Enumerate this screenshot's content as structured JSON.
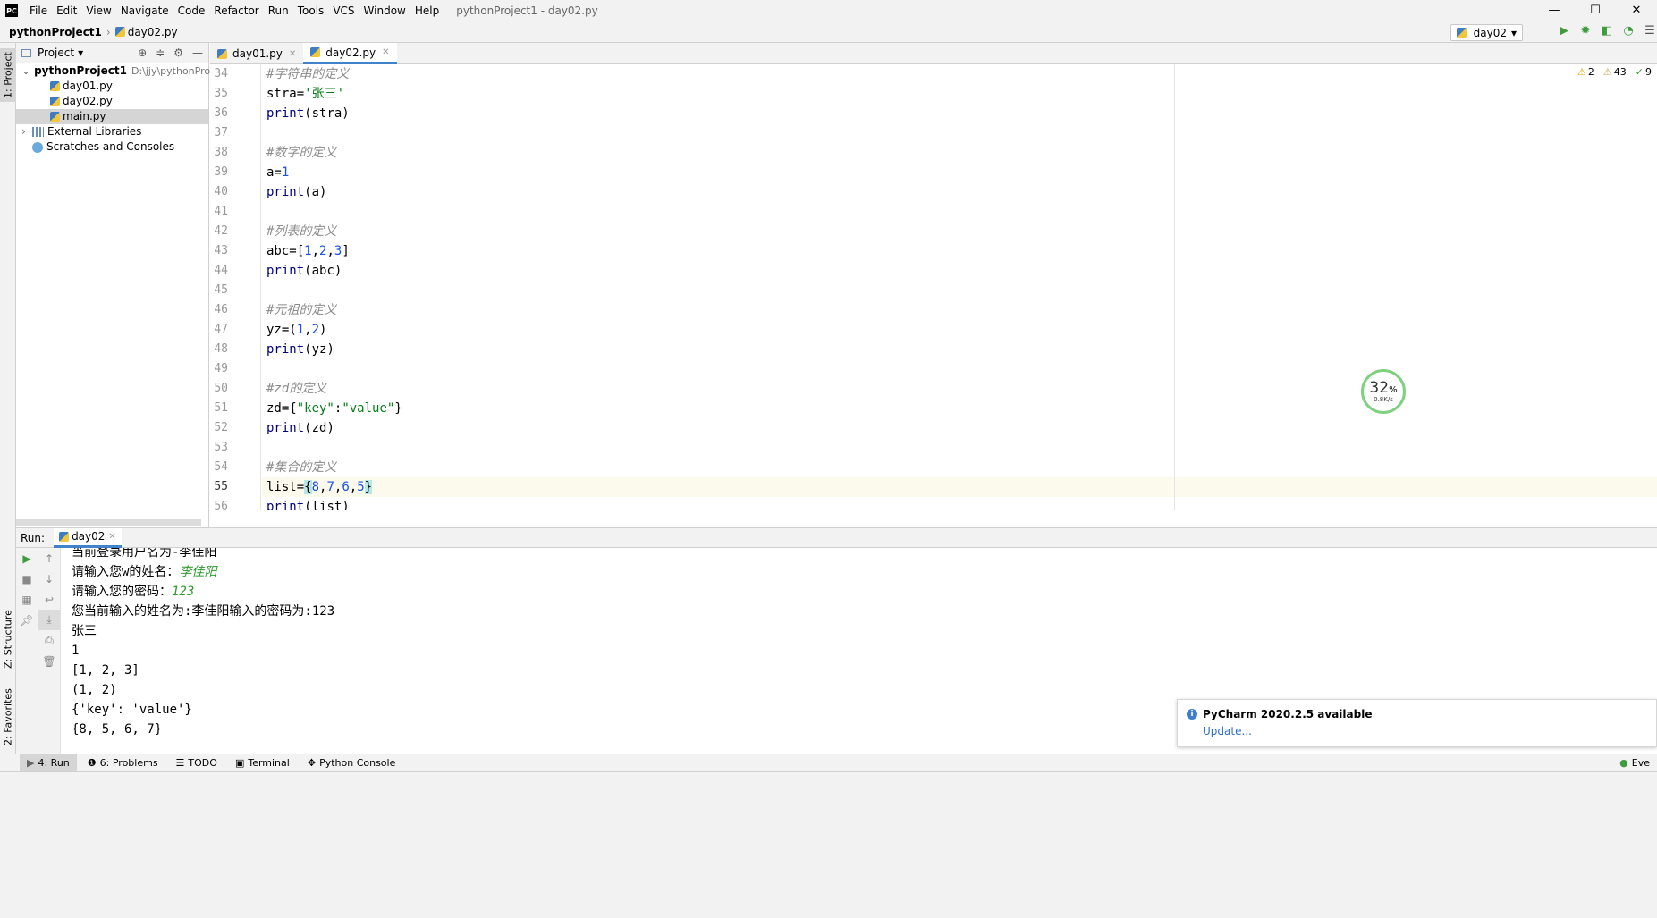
{
  "menubar": {
    "items": [
      "File",
      "Edit",
      "View",
      "Navigate",
      "Code",
      "Refactor",
      "Run",
      "Tools",
      "VCS",
      "Window",
      "Help"
    ],
    "title": "pythonProject1 - day02.py"
  },
  "navbar": {
    "project": "pythonProject1",
    "file": "day02.py",
    "run_config": "day02"
  },
  "project_panel": {
    "title": "Project",
    "root": "pythonProject1",
    "root_path": "D:\\jjy\\pythonProject",
    "files": [
      "day01.py",
      "day02.py",
      "main.py"
    ],
    "external": "External Libraries",
    "scratches": "Scratches and Consoles"
  },
  "left_stripe": {
    "project": "1: Project",
    "structure": "Z: Structure",
    "favorites": "2: Favorites"
  },
  "editor": {
    "tabs": [
      "day01.py",
      "day02.py"
    ],
    "inspection": {
      "warnings": "2",
      "weak": "43",
      "ok": "9"
    }
  },
  "net_meter": {
    "percent": "32",
    "unit": "%",
    "speed": "0.8K/s"
  },
  "run_panel": {
    "label": "Run:",
    "tab": "day02"
  },
  "console": {
    "line1": "当前登录用户名为-李佳阳",
    "prompt_name": "请输入您w的姓名：",
    "input_name": "李佳阳",
    "prompt_pwd": "请输入您的密码：",
    "input_pwd": "123",
    "line4": "您当前输入的姓名为:李佳阳输入的密码为:123",
    "line5": "张三",
    "line6": "1",
    "line7": "[1, 2, 3]",
    "line8": "(1, 2)",
    "line9": "{'key': 'value'}",
    "line10": "{8, 5, 6, 7}"
  },
  "notification": {
    "title": "PyCharm 2020.2.5 available",
    "link": "Update..."
  },
  "bottom_tabs": {
    "run": "4: Run",
    "problems": "6: Problems",
    "todo": "TODO",
    "terminal": "Terminal",
    "python_console": "Python Console",
    "event": "Eve"
  }
}
